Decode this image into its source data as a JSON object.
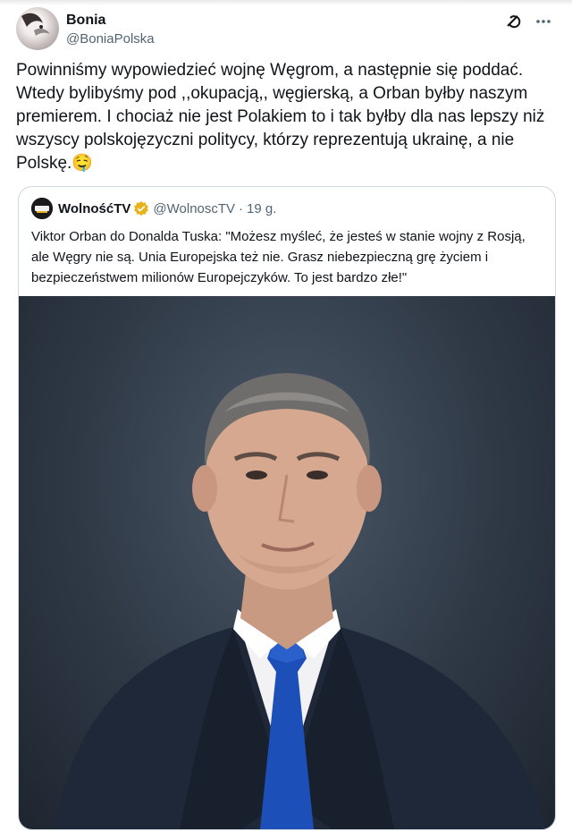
{
  "author": {
    "display_name": "Bonia",
    "handle": "@BoniaPolska"
  },
  "header_icons": [
    "grok-icon",
    "more-icon"
  ],
  "tweet": {
    "text": "Powinniśmy wypowiedzieć wojnę Węgrom, a następnie się poddać. Wtedy bylibyśmy pod ,,okupacją,, węgierską, a Orban byłby naszym premierem. I chociaż nie jest Polakiem to i tak byłby dla nas lepszy niż wszyscy polskojęzyczni politycy, którzy reprezentują ukrainę, a nie Polskę.",
    "emoji": "🤤"
  },
  "quoted": {
    "display_name": "WolnośćTV",
    "handle": "@WolnoscTV",
    "separator": "·",
    "time": "19 g.",
    "verified_color": "#e8b21a",
    "text": "Viktor Orban do Donalda Tuska: \"Możesz myśleć, że jesteś w stanie wojny z Rosją, ale Węgry nie są. Unia Europejska też nie. Grasz niebezpieczną grę życiem i bezpieczeństwem milionów Europejczyków. To jest bardzo złe!\""
  },
  "colors": {
    "text_primary": "#0f1419",
    "text_secondary": "#536471",
    "border": "#cfd9de",
    "tie_blue": "#1d4fb8"
  }
}
